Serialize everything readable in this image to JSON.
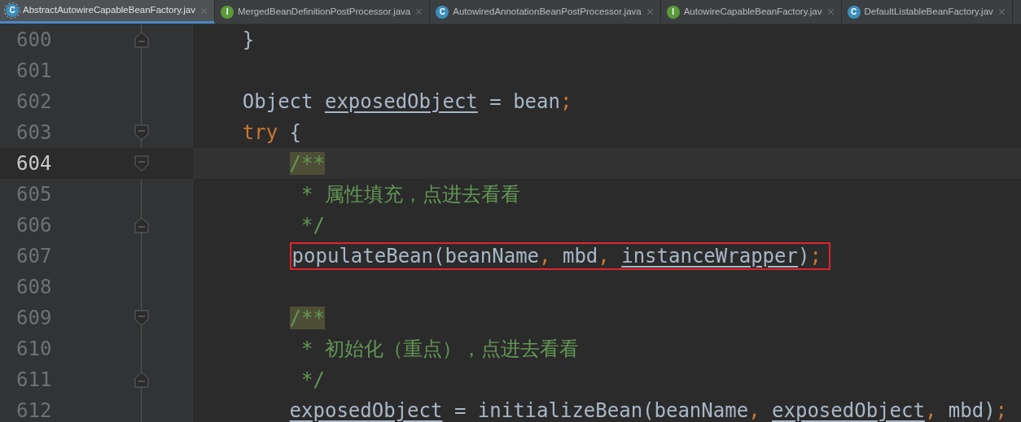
{
  "tabs": [
    {
      "icon": {
        "kind": "abstract_class",
        "letter": "C"
      },
      "label": "AbstractAutowireCapableBeanFactory.jav",
      "selected": true
    },
    {
      "icon": {
        "kind": "interface",
        "letter": "I"
      },
      "label": "MergedBeanDefinitionPostProcessor.java",
      "selected": false
    },
    {
      "icon": {
        "kind": "class",
        "letter": "C"
      },
      "label": "AutowiredAnnotationBeanPostProcessor.java",
      "selected": false
    },
    {
      "icon": {
        "kind": "interface",
        "letter": "I"
      },
      "label": "AutowireCapableBeanFactory.jav",
      "selected": false
    },
    {
      "icon": {
        "kind": "class",
        "letter": "C"
      },
      "label": "DefaultListableBeanFactory.jav",
      "selected": false
    }
  ],
  "editor": {
    "lines": [
      {
        "number": "600",
        "fold_marker": {
          "kind": "end"
        },
        "current": false,
        "tokens": [
          {
            "kind": "plain",
            "text": "    }"
          }
        ]
      },
      {
        "number": "601",
        "current": false
      },
      {
        "number": "602",
        "current": false,
        "tokens": [
          {
            "kind": "plain",
            "text": "    Object "
          },
          {
            "kind": "field",
            "text": "exposedObject"
          },
          {
            "kind": "plain",
            "text": " = bean"
          },
          {
            "kind": "punct",
            "text": ";"
          }
        ]
      },
      {
        "number": "603",
        "fold_marker": {
          "kind": "start"
        },
        "current": false,
        "tokens": [
          {
            "kind": "keyword",
            "text": "    try"
          },
          {
            "kind": "plain",
            "text": " {"
          }
        ]
      },
      {
        "number": "604",
        "fold_marker": {
          "kind": "start"
        },
        "current": true,
        "tokens": [
          {
            "kind": "doc_open",
            "text": "        /**"
          }
        ]
      },
      {
        "number": "605",
        "current": false,
        "tokens": [
          {
            "kind": "comment",
            "text": "         * 属性填充，点进去看看"
          }
        ]
      },
      {
        "number": "606",
        "fold_marker": {
          "kind": "end"
        },
        "current": false,
        "tokens": [
          {
            "kind": "comment",
            "text": "         */"
          }
        ]
      },
      {
        "number": "607",
        "current": false,
        "boxed": true,
        "tokens": [
          {
            "kind": "plain",
            "text": "        populateBean(beanName"
          },
          {
            "kind": "punct",
            "text": ", "
          },
          {
            "kind": "plain",
            "text": "mbd"
          },
          {
            "kind": "punct",
            "text": ", "
          },
          {
            "kind": "field",
            "text": "instanceWrapper"
          },
          {
            "kind": "plain",
            "text": ")"
          },
          {
            "kind": "punct",
            "text": ";"
          }
        ]
      },
      {
        "number": "608",
        "current": false
      },
      {
        "number": "609",
        "fold_marker": {
          "kind": "start"
        },
        "current": false,
        "tokens": [
          {
            "kind": "doc_open",
            "text": "        /**"
          }
        ]
      },
      {
        "number": "610",
        "current": false,
        "tokens": [
          {
            "kind": "comment",
            "text": "         * 初始化（重点），点进去看看"
          }
        ]
      },
      {
        "number": "611",
        "fold_marker": {
          "kind": "end"
        },
        "current": false,
        "tokens": [
          {
            "kind": "comment",
            "text": "         */"
          }
        ]
      },
      {
        "number": "612",
        "current": false,
        "tokens": [
          {
            "kind": "field",
            "text": "        exposedObject"
          },
          {
            "kind": "plain",
            "text": " = initializeBean(beanName"
          },
          {
            "kind": "punct",
            "text": ", "
          },
          {
            "kind": "field",
            "text": "exposedObject"
          },
          {
            "kind": "punct",
            "text": ", "
          },
          {
            "kind": "plain",
            "text": "mbd)"
          },
          {
            "kind": "punct",
            "text": ";"
          }
        ]
      }
    ]
  }
}
